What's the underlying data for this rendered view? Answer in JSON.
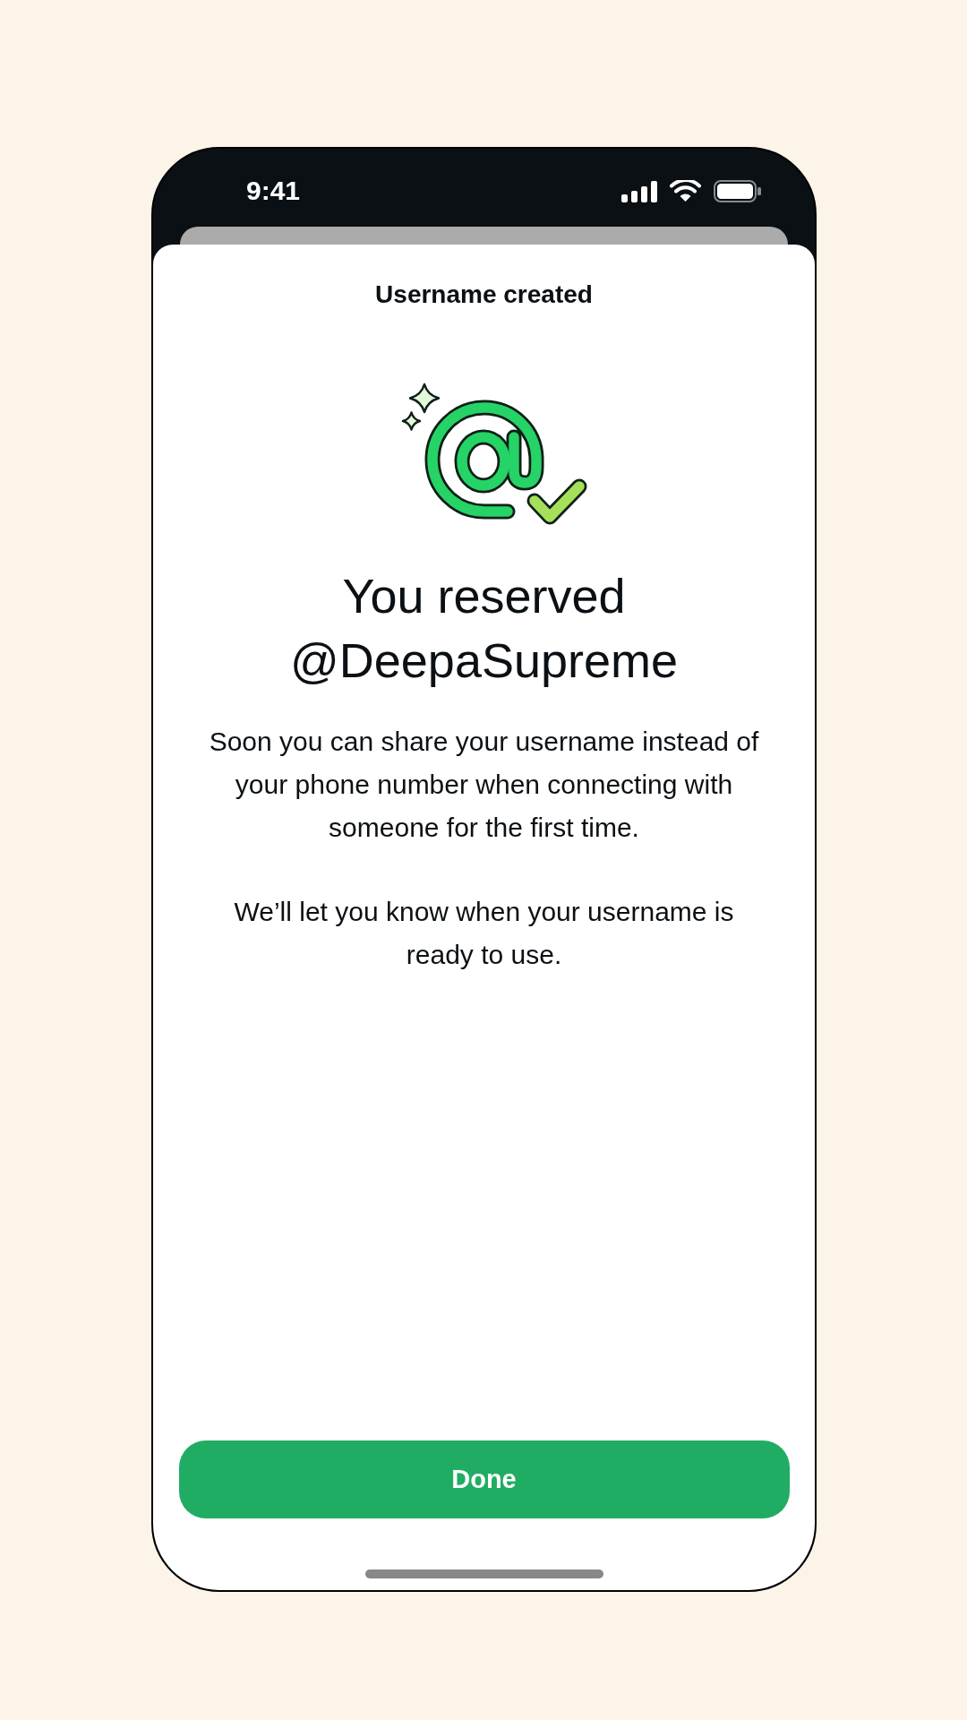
{
  "status_bar": {
    "time": "9:41"
  },
  "sheet": {
    "title": "Username created",
    "heading": "You reserved @DeepaSupreme",
    "paragraphs": [
      "Soon you can share your username instead of your phone number when connecting with someone for the first time.",
      "We’ll let you know when your username is ready to use."
    ],
    "button": {
      "label": "Done"
    }
  }
}
